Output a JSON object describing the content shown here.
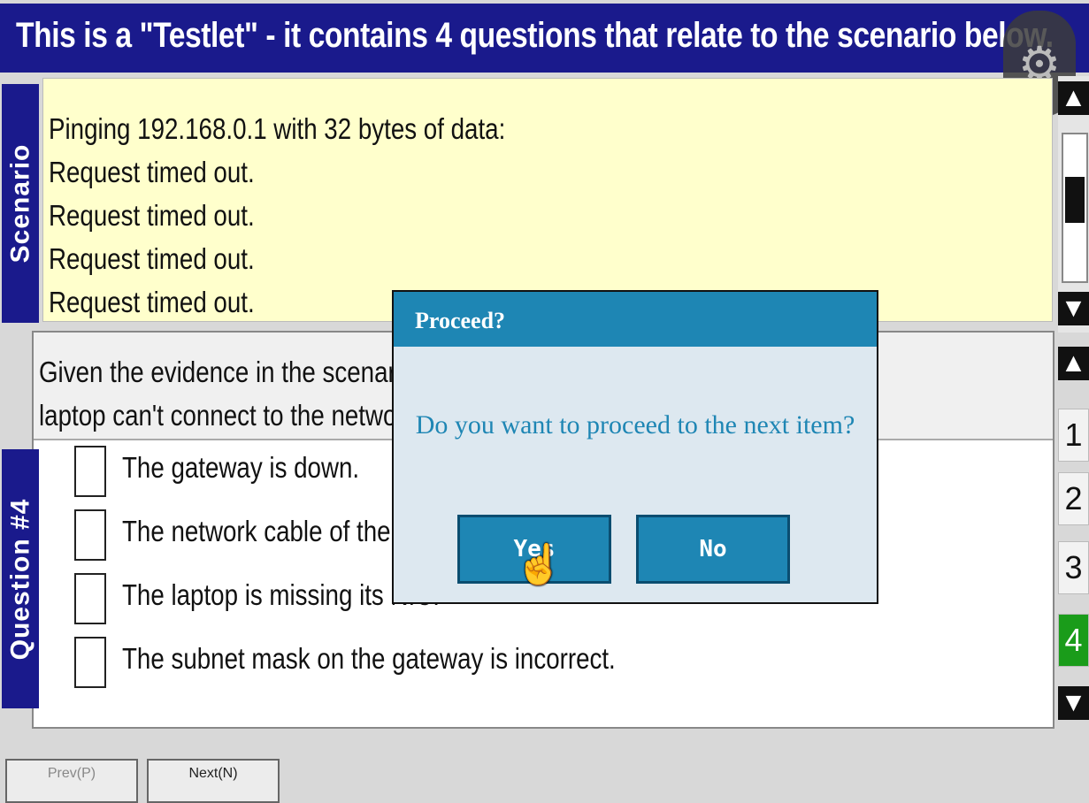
{
  "header": {
    "title": "This is a \"Testlet\"  - it contains 4 questions that relate to the scenario below."
  },
  "scenario": {
    "tab_label": "Scenario",
    "lines": [
      "Pinging 192.168.0.1 with 32 bytes of data:",
      "Request timed out.",
      "Request timed out.",
      "Request timed out.",
      "Request timed out."
    ]
  },
  "question": {
    "tab_label": "Question #4",
    "text_line1": "Given the evidence in the scenario, which of the following is why the",
    "text_line2": "laptop can't connect to the network?",
    "options": [
      "The gateway is down.",
      "The network cable of the laptop is not plugged into the wall jack.",
      "The laptop is missing its NIC.",
      "The subnet mask on the gateway is incorrect."
    ]
  },
  "nav": {
    "questions": [
      "1",
      "2",
      "3",
      "4"
    ],
    "active": "4"
  },
  "bottom": {
    "prev_label": "Prev(P)",
    "next_label": "Next(N)"
  },
  "dialog": {
    "title": "Proceed?",
    "message": "Do you want to proceed to the next item?",
    "yes_label": "Yes",
    "no_label": "No"
  },
  "colors": {
    "header_bg": "#1a1a8c",
    "scenario_bg": "#ffffcc",
    "dialog_accent": "#1e86b4",
    "active_nav": "#1a9c1a"
  }
}
